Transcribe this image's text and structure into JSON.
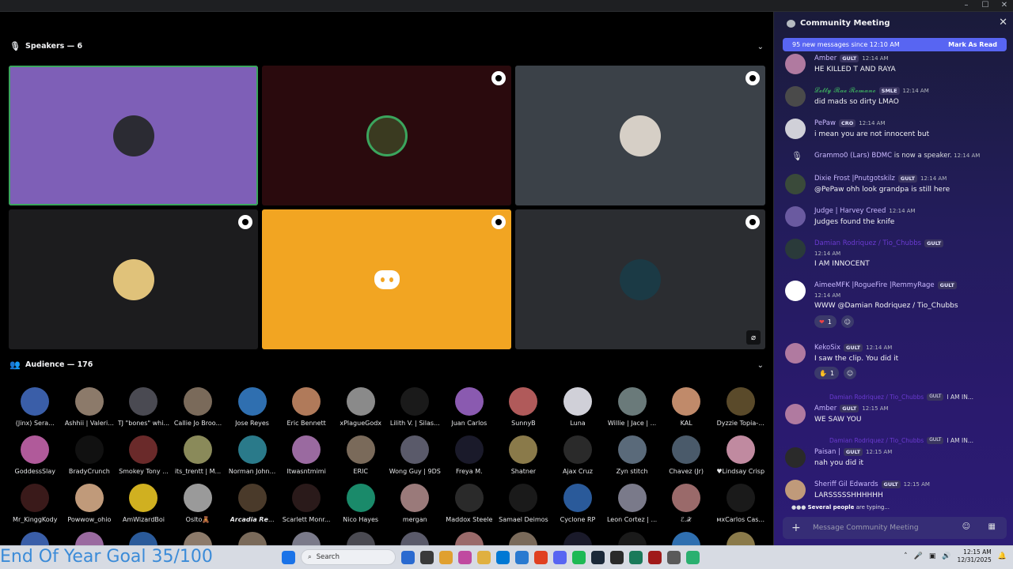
{
  "window": {
    "controls": [
      "–",
      "☐",
      "✕"
    ]
  },
  "stage": {
    "speakers_label": "Speakers — 6",
    "audience_label": "Audience — 176",
    "speakers": [
      {
        "bg": "#7e5fb7",
        "avatar": "#2b2b33",
        "speaking": true,
        "badge": false
      },
      {
        "bg": "#2a0a0d",
        "avatar": "#3a3a20",
        "speaking": false,
        "badge": true
      },
      {
        "bg": "#3b4148",
        "avatar": "#d6cfc6",
        "speaking": false,
        "badge": true
      },
      {
        "bg": "#1c1c1e",
        "avatar": "#e0c27a",
        "speaking": false,
        "badge": true
      },
      {
        "bg": "#f2a522",
        "avatar": "discord",
        "speaking": false,
        "badge": true
      },
      {
        "bg": "#2b2d31",
        "avatar": "#1b3a45",
        "speaking": false,
        "badge": true,
        "muted": true
      }
    ],
    "audience_rows": [
      [
        {
          "name": "(Jinx) Sera...",
          "c": "#3a5ea8"
        },
        {
          "name": "Ashhii | Valeri...",
          "c": "#8c7a6a"
        },
        {
          "name": "TJ \"bones\" whi...",
          "c": "#4a4a52"
        },
        {
          "name": "Callie Jo Broo...",
          "c": "#7a6a5a"
        },
        {
          "name": "Jose Reyes",
          "c": "#2f6fb0"
        },
        {
          "name": "Eric Bennett",
          "c": "#b07a5a"
        },
        {
          "name": "xPlagueGodx",
          "c": "#8a8a8a"
        },
        {
          "name": "Lilith V. | Silas...",
          "c": "#1a1a1a"
        },
        {
          "name": "Juan Carlos",
          "c": "#8a5ab0"
        },
        {
          "name": "SunnyB",
          "c": "#b05a5a"
        },
        {
          "name": "Luna",
          "c": "#d0d0d8"
        },
        {
          "name": "Willie | Jace | ...",
          "c": "#6a7a7a"
        },
        {
          "name": "KAL",
          "c": "#c08a6a"
        },
        {
          "name": "Dyzzie Topia-...",
          "c": "#5a4a2a"
        }
      ],
      [
        {
          "name": "GoddessSlay",
          "c": "#b05a9a"
        },
        {
          "name": "BradyCrunch",
          "c": "#111111"
        },
        {
          "name": "Smokey Tony ...",
          "c": "#6a2a2a"
        },
        {
          "name": "its_trentt | M...",
          "c": "#8a8a5a"
        },
        {
          "name": "Norman John...",
          "c": "#2a7a8a"
        },
        {
          "name": "Itwasntmimi",
          "c": "#9a6aa0"
        },
        {
          "name": "ERIC",
          "c": "#7a6a5a"
        },
        {
          "name": "Wong Guy | 9DS",
          "c": "#5a5a6a"
        },
        {
          "name": "Freya M.",
          "c": "#1a1a2a"
        },
        {
          "name": "Shatner",
          "c": "#8a7a4a"
        },
        {
          "name": "Ajax Cruz",
          "c": "#2a2a2a"
        },
        {
          "name": "Zyn stitch",
          "c": "#5a6a7a"
        },
        {
          "name": "Chavez (Jr)",
          "c": "#4a5a6a"
        },
        {
          "name": "♥Lindsay Crisp",
          "c": "#c08aa0"
        }
      ],
      [
        {
          "name": "Mr_KinggKody",
          "c": "#3a1a1a"
        },
        {
          "name": "Powwow_ohio",
          "c": "#c09a7a"
        },
        {
          "name": "AmWizardBoi",
          "c": "#d0b020"
        },
        {
          "name": "Oslto🧸",
          "c": "#9a9a9a"
        },
        {
          "name": "𝘼𝙧𝙘𝙖𝙙𝙞𝙖 𝙍𝙚...",
          "c": "#4a3a2a"
        },
        {
          "name": "Scarlett Monr...",
          "c": "#2a1a1a"
        },
        {
          "name": "Nico Hayes",
          "c": "#1a8a6a"
        },
        {
          "name": "mergan",
          "c": "#9a7a7a"
        },
        {
          "name": "Maddox Steele",
          "c": "#2a2a2a"
        },
        {
          "name": "Samael Deimos",
          "c": "#1a1a1a"
        },
        {
          "name": "Cyclone RP",
          "c": "#2a5a9a"
        },
        {
          "name": "Leon Cortez | ...",
          "c": "#7a7a8a"
        },
        {
          "name": "ℰ.𝒳",
          "c": "#9a6a6a"
        },
        {
          "name": "мxCarlos Cas...",
          "c": "#1a1a1a"
        }
      ]
    ]
  },
  "chat": {
    "title": "Community Meeting",
    "new_messages": "95 new messages since 12:10 AM",
    "mark_as_read": "Mark As Read",
    "messages": [
      {
        "author": "Amber",
        "tag": "GULT",
        "ts": "12:14 AM",
        "text": "HE KILLED T AND RAYA",
        "color": "#c9b8ff",
        "av": "#b07aa0"
      },
      {
        "author": "𝓛𝓮𝓽𝓽𝔂 𝓡𝓪𝓮 𝓡𝓸𝓶𝓪𝓷𝓸",
        "tag": "SMLE",
        "ts": "12:14 AM",
        "text": "did mads so dirty LMAO",
        "color": "#3ba55d",
        "av": "#4a4a4a"
      },
      {
        "author": "PePaw",
        "tag": "CRO",
        "ts": "12:14 AM",
        "text": "i mean you are not innocent but",
        "color": "#c9b8ff",
        "av": "#d0d0d8"
      },
      {
        "author": "Dixie Frost |Pnutgotskilz",
        "tag": "GULT",
        "ts": "12:14 AM",
        "text": "@PePaw ohh look grandpa is still here",
        "color": "#c9b8ff",
        "av": "#3a4a3a"
      },
      {
        "author": "Judge | Harvey Creed",
        "tag": "",
        "ts": "12:14 AM",
        "text": "Judges found the knife",
        "color": "#c9b8ff",
        "av": "#6a5aa0"
      },
      {
        "author": "Damian Rodriquez / Tio_Chubbs",
        "tag": "GULT",
        "ts": "12:14 AM",
        "text": "I AM INNOCENT",
        "color": "#6a3ad0",
        "av": "#2a3a3a"
      },
      {
        "author": "AimeeMFK |RogueFire |RemmyRage",
        "tag": "GULT",
        "ts": "12:14 AM",
        "text": "WWW @Damian Rodriquez / Tio_Chubbs",
        "color": "#c9b8ff",
        "av": "#ffffff"
      },
      {
        "author": "KekoSix",
        "tag": "GULT",
        "ts": "12:14 AM",
        "text": "I saw the clip. You did it",
        "color": "#c9b8ff",
        "av": "#b07aa0"
      },
      {
        "author": "Amber",
        "tag": "GULT",
        "ts": "12:15 AM",
        "text": "WE SAW YOU",
        "color": "#c9b8ff",
        "av": "#b07aa0"
      },
      {
        "author": "Paisan |",
        "tag": "GULT",
        "ts": "12:15 AM",
        "text": "nah you did it",
        "color": "#c9b8ff",
        "av": "#2a2a2a"
      },
      {
        "author": "Sheriff Gil Edwards",
        "tag": "GULT",
        "ts": "12:15 AM",
        "text": "LARSSSSSHHHHHH",
        "color": "#c9b8ff",
        "av": "#c09a7a"
      }
    ],
    "system_msg": {
      "name": "Grammo0  (Lars)  BDMC",
      "text": " is now a speaker.",
      "ts": "12:14 AM"
    },
    "reply_preview": {
      "name": "Damian Rodriquez / Tio_Chubbs",
      "tag": "GULT",
      "text": "I AM IN..."
    },
    "reactions": {
      "heart": "1",
      "two": "1"
    },
    "typing": "Several people are typing...",
    "typing_bold": "Several people",
    "typing_rest": " are typing...",
    "placeholder": "Message Community Meeting"
  },
  "taskbar": {
    "goal": "End Of Year Goal 35/100",
    "search": "Search",
    "time": "12:15 AM",
    "date": "12/31/2025",
    "apps": [
      "#2a6ad0",
      "#3a3a3a",
      "#e0a030",
      "#c04aa0",
      "#e0b040",
      "#0078d4",
      "#2a7ad0",
      "#e04020",
      "#5865f2",
      "#1db954",
      "#1b2838",
      "#2a2a2a",
      "#1a7a5a",
      "#a01a1a",
      "#5a5a5a",
      "#2ab070"
    ]
  }
}
